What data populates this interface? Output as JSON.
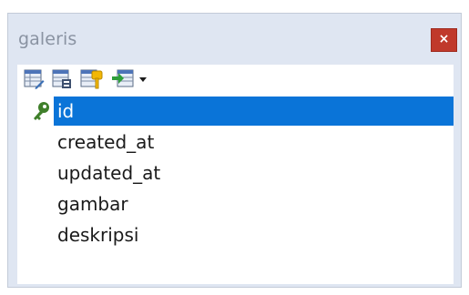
{
  "window": {
    "title": "galeris",
    "close_label": "×"
  },
  "toolbar": {
    "buttons": [
      {
        "icon": "edit-table-icon"
      },
      {
        "icon": "table-properties-icon"
      },
      {
        "icon": "table-keys-icon"
      },
      {
        "icon": "export-table-icon"
      }
    ],
    "dropdown_icon": "chevron-down-icon"
  },
  "fields": [
    {
      "name": "id",
      "primary_key": true,
      "selected": true
    },
    {
      "name": "created_at",
      "primary_key": false,
      "selected": false
    },
    {
      "name": "updated_at",
      "primary_key": false,
      "selected": false
    },
    {
      "name": "gambar",
      "primary_key": false,
      "selected": false
    },
    {
      "name": "deskripsi",
      "primary_key": false,
      "selected": false
    }
  ],
  "colors": {
    "panel_bg": "#dfe6f2",
    "selection": "#0a74d8",
    "close_button": "#c0392b",
    "title_text": "#8a93a2",
    "key_icon": "#3f7f2a"
  }
}
